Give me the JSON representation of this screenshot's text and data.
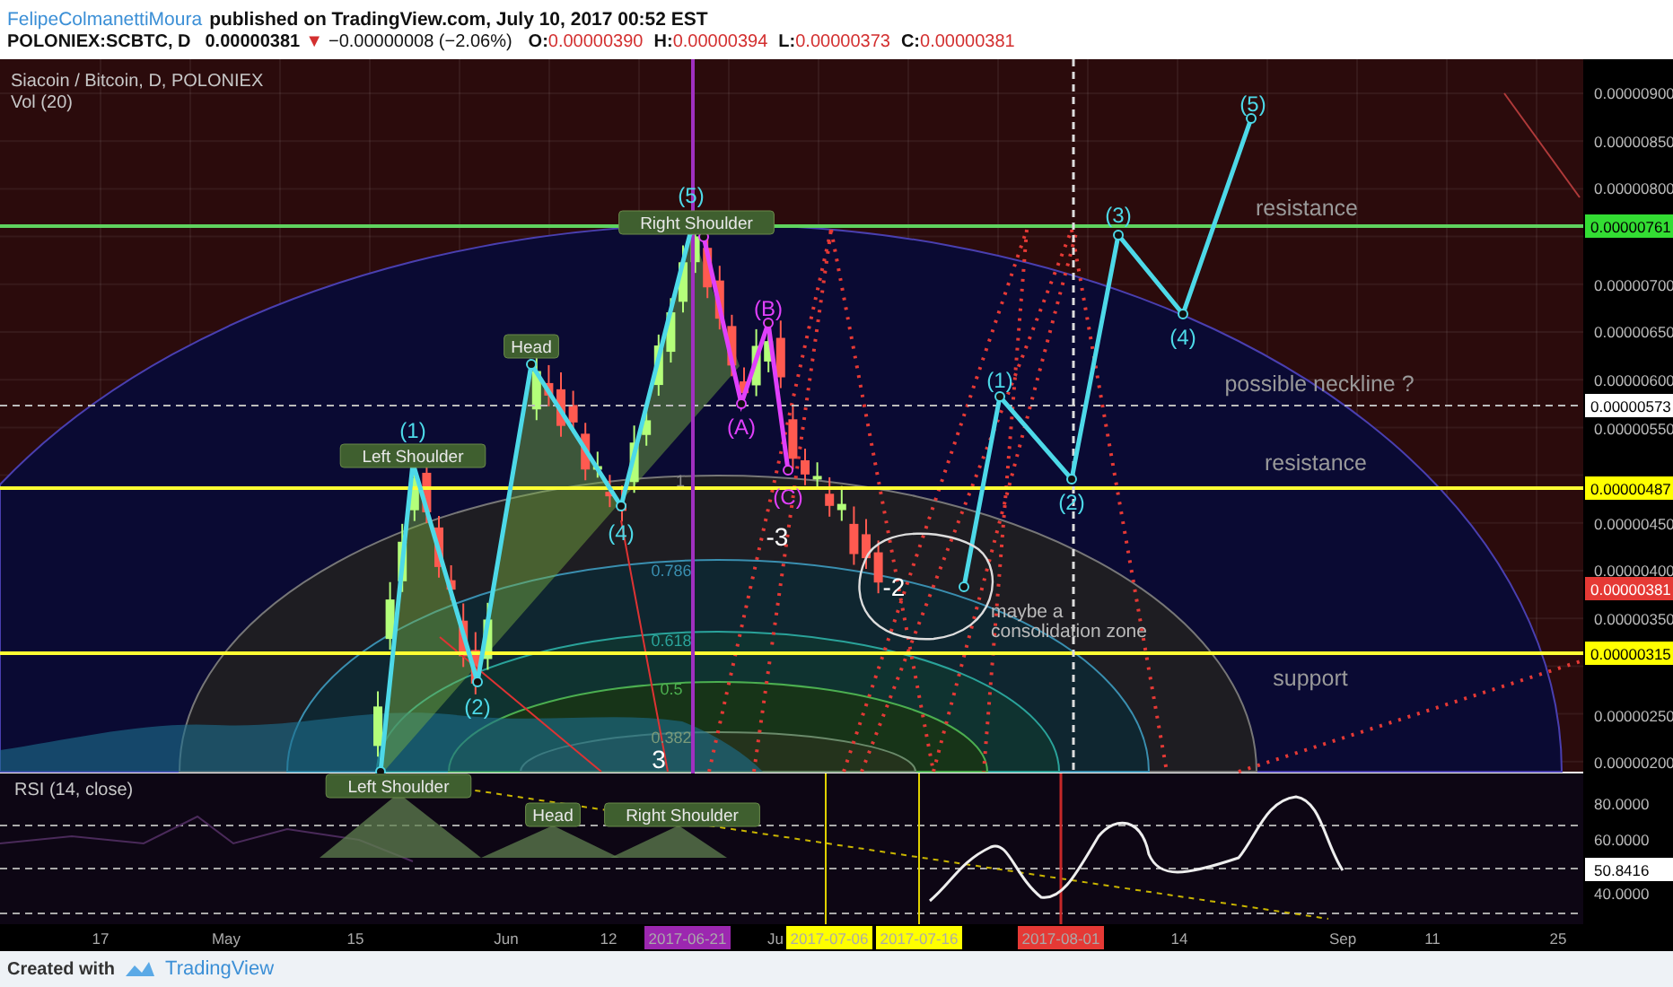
{
  "header": {
    "author": "FelipeColmanettiMoura",
    "published": "published on TradingView.com, July 10, 2017 00:52 EST",
    "symbol": "POLONIEX:SCBTC, D",
    "price": "0.00000381",
    "direction_icon": "▼",
    "change": "−0.00000008 (−2.06%)",
    "ohlc": [
      {
        "label": "O:",
        "value": "0.00000390"
      },
      {
        "label": "H:",
        "value": "0.00000394"
      },
      {
        "label": "L:",
        "value": "0.00000373"
      },
      {
        "label": "C:",
        "value": "0.00000381"
      }
    ]
  },
  "chart": {
    "title": "Siacoin / Bitcoin, D, POLONIEX",
    "volume_label": "Vol (20)",
    "price_axis": [
      "0.00000900",
      "0.00000850",
      "0.00000800",
      "0.00000700",
      "0.00000650",
      "0.00000600",
      "0.00000550",
      "0.00000450",
      "0.00000400",
      "0.00000350",
      "0.00000250",
      "0.00000200"
    ],
    "price_tags": [
      {
        "value": "0.00000761",
        "color": "#33dd33"
      },
      {
        "value": "0.00000573",
        "color": "#ffffff"
      },
      {
        "value": "0.00000487",
        "color": "#ffff00"
      },
      {
        "value": "0.00000381",
        "color": "#e53935"
      },
      {
        "value": "0.00000315",
        "color": "#ffff00"
      }
    ],
    "annotations": [
      {
        "kind": "badge",
        "text": "Left Shoulder"
      },
      {
        "kind": "wave",
        "text": "(1)",
        "color": "#4dd9e8"
      },
      {
        "kind": "badge",
        "text": "Head"
      },
      {
        "kind": "wave",
        "text": "(5)",
        "color": "#4dd9e8"
      },
      {
        "kind": "badge",
        "text": "Right Shoulder"
      },
      {
        "kind": "wave",
        "text": "(2)",
        "color": "#4dd9e8"
      },
      {
        "kind": "wave",
        "text": "(4)",
        "color": "#4dd9e8"
      },
      {
        "kind": "wave",
        "text": "(A)",
        "color": "#e040fb"
      },
      {
        "kind": "wave",
        "text": "(B)",
        "color": "#e040fb"
      },
      {
        "kind": "wave",
        "text": "(C)",
        "color": "#e040fb"
      },
      {
        "kind": "count",
        "text": "-3"
      },
      {
        "kind": "count",
        "text": "-2"
      },
      {
        "kind": "count",
        "text": "3"
      },
      {
        "kind": "fib",
        "text": "1",
        "color": "#8a8a8a"
      },
      {
        "kind": "fib",
        "text": "0.786",
        "color": "#3a8fb0"
      },
      {
        "kind": "fib",
        "text": "0.618",
        "color": "#2aa39a"
      },
      {
        "kind": "fib",
        "text": "0.5",
        "color": "#4caf50"
      },
      {
        "kind": "fib",
        "text": "0.382",
        "color": "#7a9a7a"
      },
      {
        "kind": "wave",
        "text": "(1)",
        "color": "#4dd9e8"
      },
      {
        "kind": "wave",
        "text": "(2)",
        "color": "#4dd9e8"
      },
      {
        "kind": "wave",
        "text": "(3)",
        "color": "#4dd9e8"
      },
      {
        "kind": "wave",
        "text": "(4)",
        "color": "#4dd9e8"
      },
      {
        "kind": "wave",
        "text": "(5)",
        "color": "#4dd9e8"
      },
      {
        "kind": "note",
        "text": "resistance"
      },
      {
        "kind": "note",
        "text": "possible neckline ?"
      },
      {
        "kind": "note",
        "text": "resistance"
      },
      {
        "kind": "note",
        "text": "support"
      },
      {
        "kind": "note_block",
        "lines": [
          "maybe a",
          "consolidation zone"
        ]
      }
    ]
  },
  "rsi": {
    "title": "RSI (14, close)",
    "axis": [
      "80.0000",
      "60.0000",
      "40.0000"
    ],
    "reading": "50.8416",
    "annotations": [
      {
        "text": "Left Shoulder"
      },
      {
        "text": "Head"
      },
      {
        "text": "Right Shoulder"
      }
    ]
  },
  "time_axis": {
    "labels": [
      "17",
      "May",
      "15",
      "Jun",
      "12",
      "Ju",
      "14",
      "Sep",
      "11",
      "25"
    ],
    "date_tags": [
      {
        "text": "2017-06-21",
        "color": "#9c27b0"
      },
      {
        "text": "2017-07-06",
        "color": "#ffff00"
      },
      {
        "text": "2017-07-16",
        "color": "#ffff00"
      },
      {
        "text": "2017-08-01",
        "color": "#e53935"
      }
    ]
  },
  "footer": {
    "created": "Created with",
    "brand": "TradingView"
  }
}
